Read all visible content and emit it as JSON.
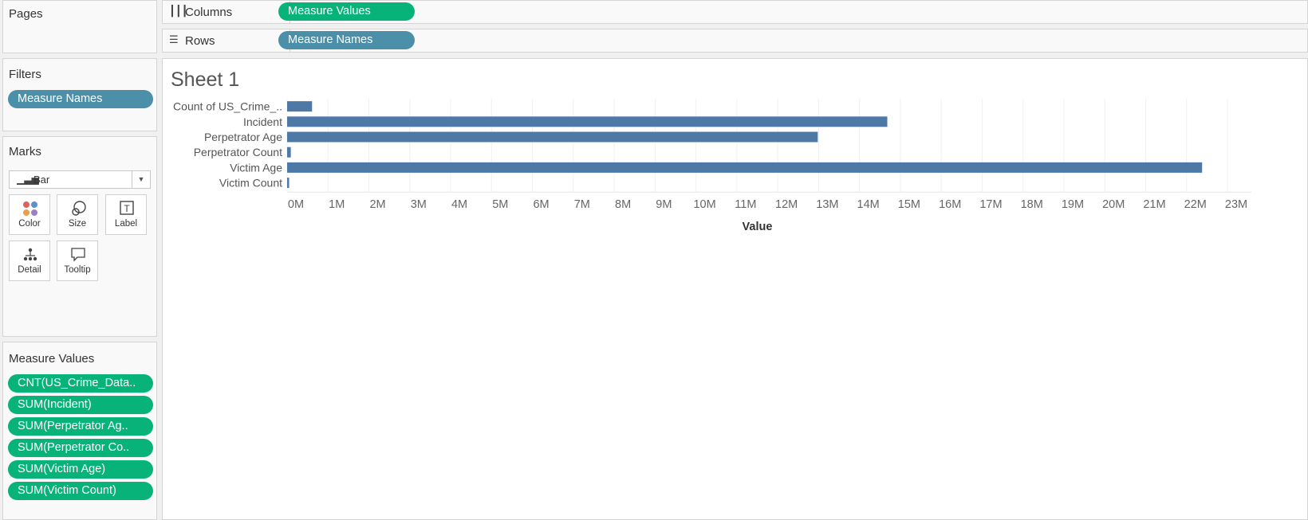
{
  "shelves": {
    "columns": {
      "label": "Columns",
      "pill": "Measure Values"
    },
    "rows": {
      "label": "Rows",
      "pill": "Measure Names"
    }
  },
  "pages": {
    "title": "Pages"
  },
  "filters": {
    "title": "Filters",
    "items": [
      "Measure Names"
    ]
  },
  "marks": {
    "title": "Marks",
    "type": "Bar",
    "buttons": [
      "Color",
      "Size",
      "Label",
      "Detail",
      "Tooltip"
    ]
  },
  "measure_values": {
    "title": "Measure Values",
    "items": [
      "CNT(US_Crime_Data..",
      "SUM(Incident)",
      "SUM(Perpetrator Ag..",
      "SUM(Perpetrator Co..",
      "SUM(Victim Age)",
      "SUM(Victim Count)"
    ]
  },
  "sheet": {
    "title": "Sheet 1"
  },
  "colors": {
    "bar": "#4e79a7",
    "pill_green": "#08b37a",
    "pill_blue": "#4b8fa9",
    "grid": "#f0f0f0"
  },
  "chart_data": {
    "type": "bar",
    "orientation": "horizontal",
    "categories": [
      "Count of US_Crime_..",
      "Incident",
      "Perpetrator Age",
      "Perpetrator Count",
      "Victim Age",
      "Victim Count"
    ],
    "values": [
      610000,
      14680000,
      12980000,
      90000,
      22380000,
      40000
    ],
    "xlabel": "Value",
    "ylabel": "",
    "xlim": [
      0,
      23000000
    ],
    "xticks": [
      "0M",
      "1M",
      "2M",
      "3M",
      "4M",
      "5M",
      "6M",
      "7M",
      "8M",
      "9M",
      "10M",
      "11M",
      "12M",
      "13M",
      "14M",
      "15M",
      "16M",
      "17M",
      "18M",
      "19M",
      "20M",
      "21M",
      "22M",
      "23M"
    ],
    "grid": true
  }
}
